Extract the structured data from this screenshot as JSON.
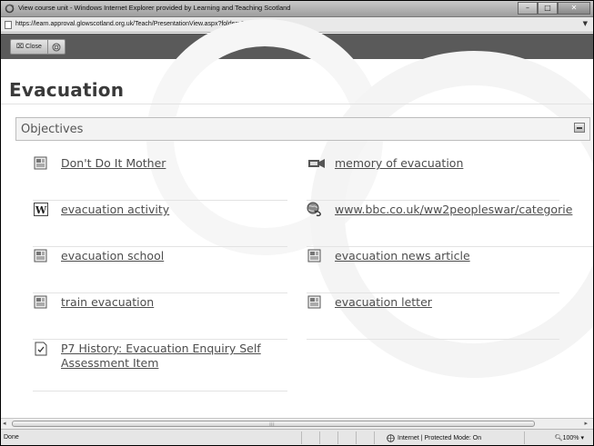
{
  "browser": {
    "title": "View course unit - Windows Internet Explorer provided by Learning and Teaching Scotland",
    "url": "https://learn.approval.glowscotland.org.uk/Teach/PresentationView.aspx?folder=Evacuation",
    "window_buttons": [
      "–",
      "□",
      "✕"
    ]
  },
  "toolbar": {
    "close_label": "⌧ Close"
  },
  "page": {
    "title": "Evacuation"
  },
  "section": {
    "title": "Objectives"
  },
  "items": [
    {
      "label": "Don't Do It Mother",
      "icon": "document-icon"
    },
    {
      "label": "memory of evacuation",
      "icon": "video-icon"
    },
    {
      "label": "evacuation activity",
      "icon": "word-icon"
    },
    {
      "label": "www.bbc.co.uk/ww2peopleswar/categorie",
      "icon": "weblink-icon"
    },
    {
      "label": "evacuation school",
      "icon": "document-icon"
    },
    {
      "label": "evacuation news article",
      "icon": "document-icon"
    },
    {
      "label": "train evacuation",
      "icon": "document-icon"
    },
    {
      "label": "evacuation letter",
      "icon": "document-icon"
    },
    {
      "label": "P7 History: Evacuation Enquiry Self Assessment Item",
      "icon": "assessment-icon"
    }
  ],
  "statusbar": {
    "status": "Done",
    "zone": "Internet | Protected Mode: On",
    "zoom": "100%"
  }
}
